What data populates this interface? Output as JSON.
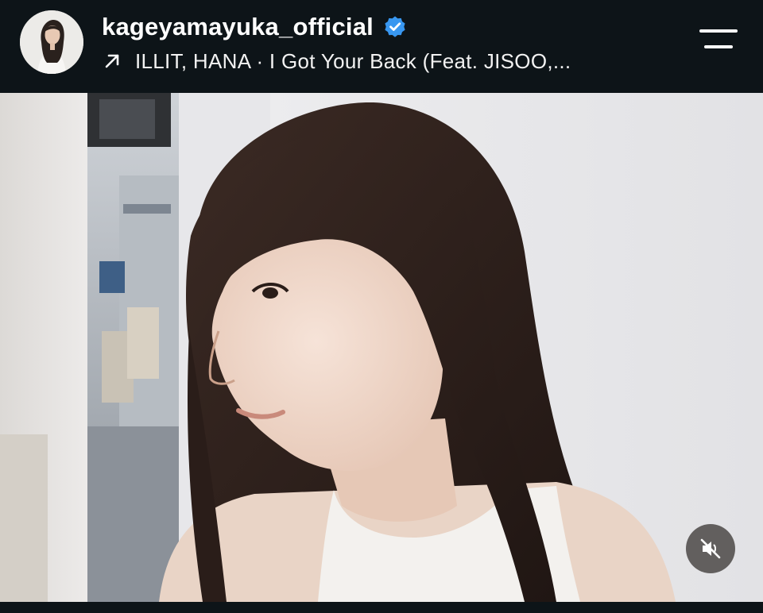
{
  "post": {
    "username": "kageyamayuka_official",
    "verified": true,
    "music": "ILLIT, HANA · I Got Your Back (Feat. JISOO,..."
  },
  "icons": {
    "verified": "verified-badge-icon",
    "music_arrow": "north-east-arrow-icon",
    "menu": "menu-icon",
    "mute": "speaker-muted-icon"
  },
  "colors": {
    "background": "#0d1418",
    "verified_blue": "#3897f0",
    "text": "#ffffff"
  }
}
